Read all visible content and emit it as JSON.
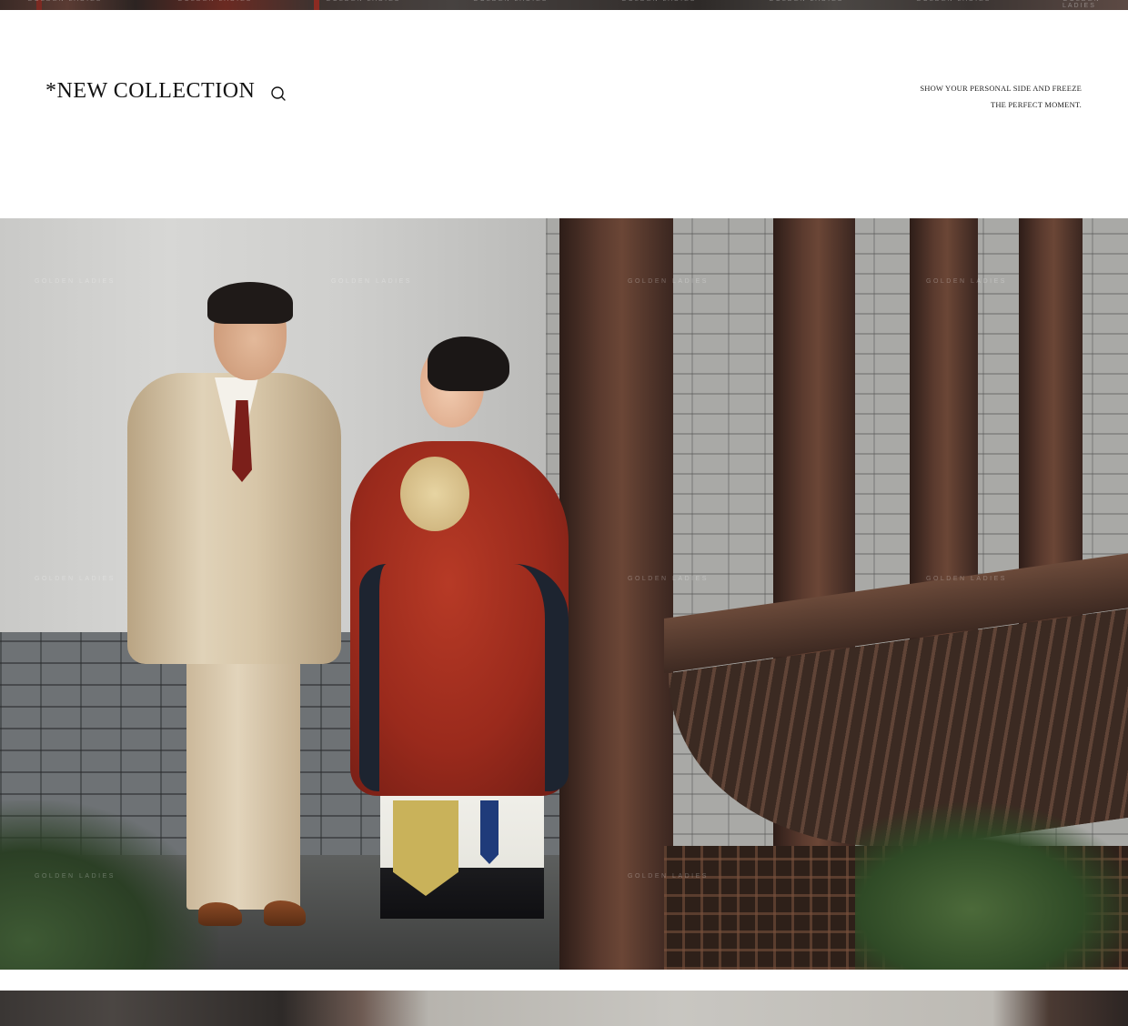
{
  "header": {
    "title": "*NEW COLLECTION",
    "search_icon": "search-icon",
    "tagline_line1": "SHOW YOUR PERSONAL SIDE AND FREEZE",
    "tagline_line2": "THE PERFECT MOMENT."
  },
  "photo": {
    "watermark": "GOLDEN LADIES"
  },
  "colors": {
    "background": "#ffffff",
    "text": "#111111",
    "robe_red": "#9a2a1c",
    "suit_beige": "#d7c6a8",
    "wood_brown": "#5a3a2e"
  }
}
